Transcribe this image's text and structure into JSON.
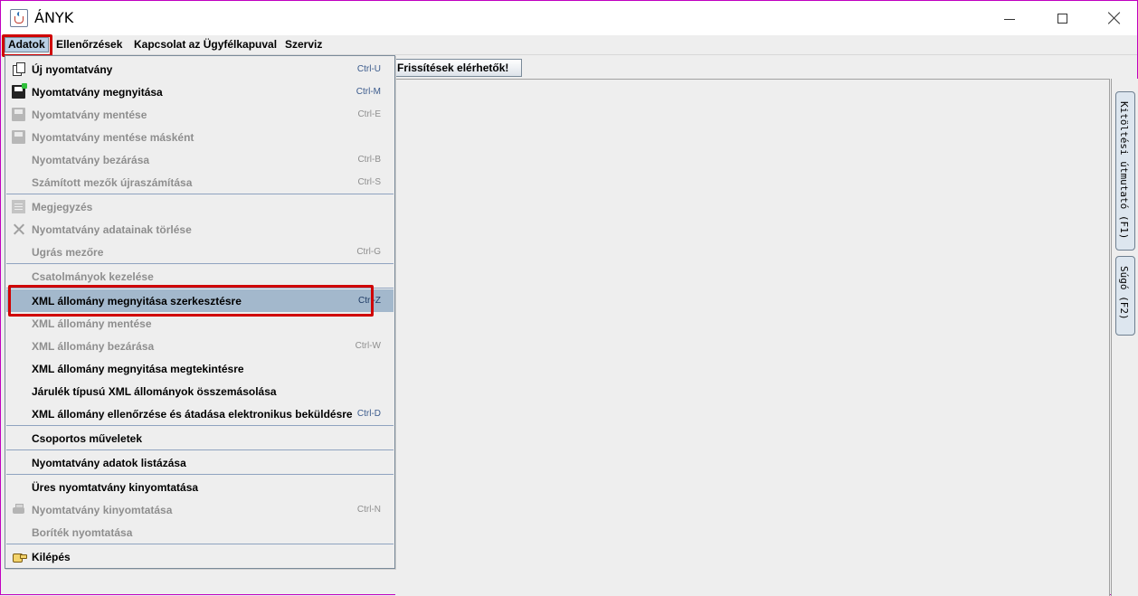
{
  "window": {
    "title": "ÁNYK"
  },
  "menubar": {
    "items": [
      "Adatok",
      "Ellenőrzések",
      "Kapcsolat az Ügyfélkapuval",
      "Szerviz"
    ]
  },
  "toolbar": {
    "updates_button": "Frissítések elérhetők!"
  },
  "side_tabs": [
    "Kitöltési útmutató (F1)",
    "Súgó (F2)"
  ],
  "menu": {
    "items": [
      {
        "label": "Új nyomtatvány",
        "accel": "Ctrl-U",
        "enabled": true,
        "icon": "new-document-icon"
      },
      {
        "label": "Nyomtatvány megnyitása",
        "accel": "Ctrl-M",
        "enabled": true,
        "icon": "floppy-open-icon"
      },
      {
        "label": "Nyomtatvány mentése",
        "accel": "Ctrl-E",
        "enabled": false,
        "icon": "save-icon"
      },
      {
        "label": "Nyomtatvány mentése másként",
        "accel": "",
        "enabled": false,
        "icon": "save-as-icon"
      },
      {
        "label": "Nyomtatvány bezárása",
        "accel": "Ctrl-B",
        "enabled": false
      },
      {
        "label": "Számított mezők újraszámítása",
        "accel": "Ctrl-S",
        "enabled": false
      },
      {
        "label": "Megjegyzés",
        "accel": "",
        "enabled": false,
        "icon": "note-icon"
      },
      {
        "label": "Nyomtatvány adatainak törlése",
        "accel": "",
        "enabled": false,
        "icon": "delete-icon"
      },
      {
        "label": "Ugrás mezőre",
        "accel": "Ctrl-G",
        "enabled": false
      },
      {
        "label": "Csatolmányok kezelése",
        "accel": "",
        "enabled": false
      },
      {
        "label": "XML állomány megnyitása szerkesztésre",
        "accel": "Ctrl-Z",
        "enabled": true,
        "selected": true
      },
      {
        "label": "XML állomány mentése",
        "accel": "",
        "enabled": false
      },
      {
        "label": "XML állomány bezárása",
        "accel": "Ctrl-W",
        "enabled": false
      },
      {
        "label": "XML állomány megnyitása megtekintésre",
        "accel": "",
        "enabled": true
      },
      {
        "label": "Járulék típusú XML állományok összemásolása",
        "accel": "",
        "enabled": true
      },
      {
        "label": "XML állomány ellenőrzése és átadása elektronikus beküldésre",
        "accel": "Ctrl-D",
        "enabled": true
      },
      {
        "label": "Csoportos műveletek",
        "accel": "",
        "enabled": true
      },
      {
        "label": "Nyomtatvány adatok listázása",
        "accel": "",
        "enabled": true
      },
      {
        "label": "Üres nyomtatvány kinyomtatása",
        "accel": "",
        "enabled": true
      },
      {
        "label": "Nyomtatvány kinyomtatása",
        "accel": "Ctrl-N",
        "enabled": false,
        "icon": "printer-icon"
      },
      {
        "label": "Boríték nyomtatása",
        "accel": "",
        "enabled": false
      },
      {
        "label": "Kilépés",
        "accel": "",
        "enabled": true,
        "icon": "exit-hand-icon"
      }
    ]
  }
}
